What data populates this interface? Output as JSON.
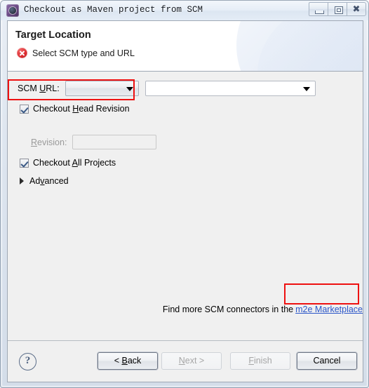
{
  "window": {
    "title": "Checkout as Maven project from SCM",
    "icon": "maven-gear-icon",
    "controls": {
      "minimize": "minimize-icon",
      "restore": "restore-icon",
      "close": "close-icon"
    }
  },
  "header": {
    "page_title": "Target Location",
    "status_icon": "error-icon",
    "status_message": "Select SCM type and URL"
  },
  "form": {
    "scm_url_label_pre": "SCM ",
    "scm_url_label_mnemonic": "U",
    "scm_url_label_post": "RL:",
    "scm_type_value": "",
    "scm_url_value": "",
    "checkout_head_pre": "Checkout ",
    "checkout_head_mnemonic": "H",
    "checkout_head_post": "ead Revision",
    "checkout_head_checked": true,
    "revision_label_mnemonic": "R",
    "revision_label_post": "evision:",
    "revision_value": "",
    "revision_enabled": false,
    "checkout_all_pre": "Checkout ",
    "checkout_all_mnemonic": "A",
    "checkout_all_post": "ll Projects",
    "checkout_all_checked": true,
    "advanced_pre": "Ad",
    "advanced_mnemonic": "v",
    "advanced_post": "anced",
    "advanced_expanded": false
  },
  "marketplace": {
    "text": "Find more SCM connectors in the",
    "link_label": "m2e Marketplace"
  },
  "buttons": {
    "help": "?",
    "back_pre": "< ",
    "back_mnemonic": "B",
    "back_post": "ack",
    "next_mnemonic": "N",
    "next_post": "ext >",
    "finish_mnemonic": "F",
    "finish_post": "inish",
    "cancel": "Cancel"
  },
  "annotations": {
    "scm_url_highlight_color": "#ee1111",
    "marketplace_highlight_color": "#ee1111"
  }
}
